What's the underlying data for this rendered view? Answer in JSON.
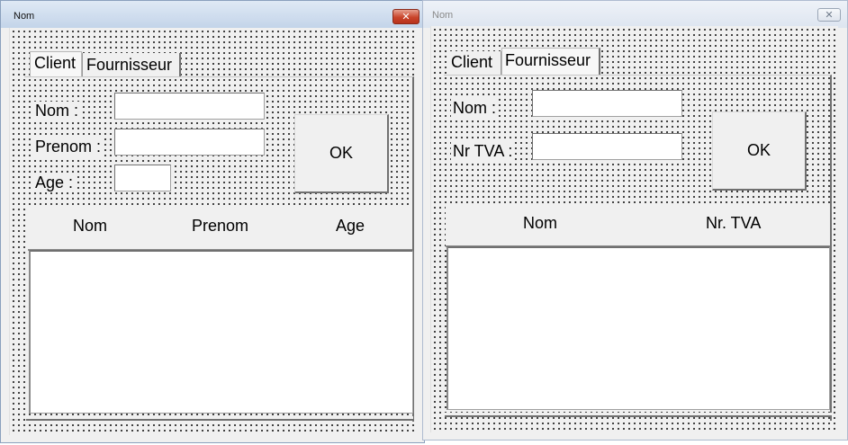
{
  "left_window": {
    "title": "Nom",
    "tabs": [
      {
        "label": "Client",
        "active": true
      },
      {
        "label": "Fournisseur",
        "active": false
      }
    ],
    "fields": [
      {
        "label": "Nom :",
        "value": ""
      },
      {
        "label": "Prenom :",
        "value": ""
      },
      {
        "label": "Age :",
        "value": ""
      }
    ],
    "ok_label": "OK",
    "list_columns": [
      "Nom",
      "Prenom",
      "Age"
    ]
  },
  "right_window": {
    "title": "Nom",
    "tabs": [
      {
        "label": "Client",
        "active": false
      },
      {
        "label": "Fournisseur",
        "active": true
      }
    ],
    "fields": [
      {
        "label": "Nom :",
        "value": ""
      },
      {
        "label": "Nr TVA :",
        "value": ""
      }
    ],
    "ok_label": "OK",
    "list_columns": [
      "Nom",
      "Nr. TVA"
    ]
  },
  "icons": {
    "close": "close-icon"
  }
}
